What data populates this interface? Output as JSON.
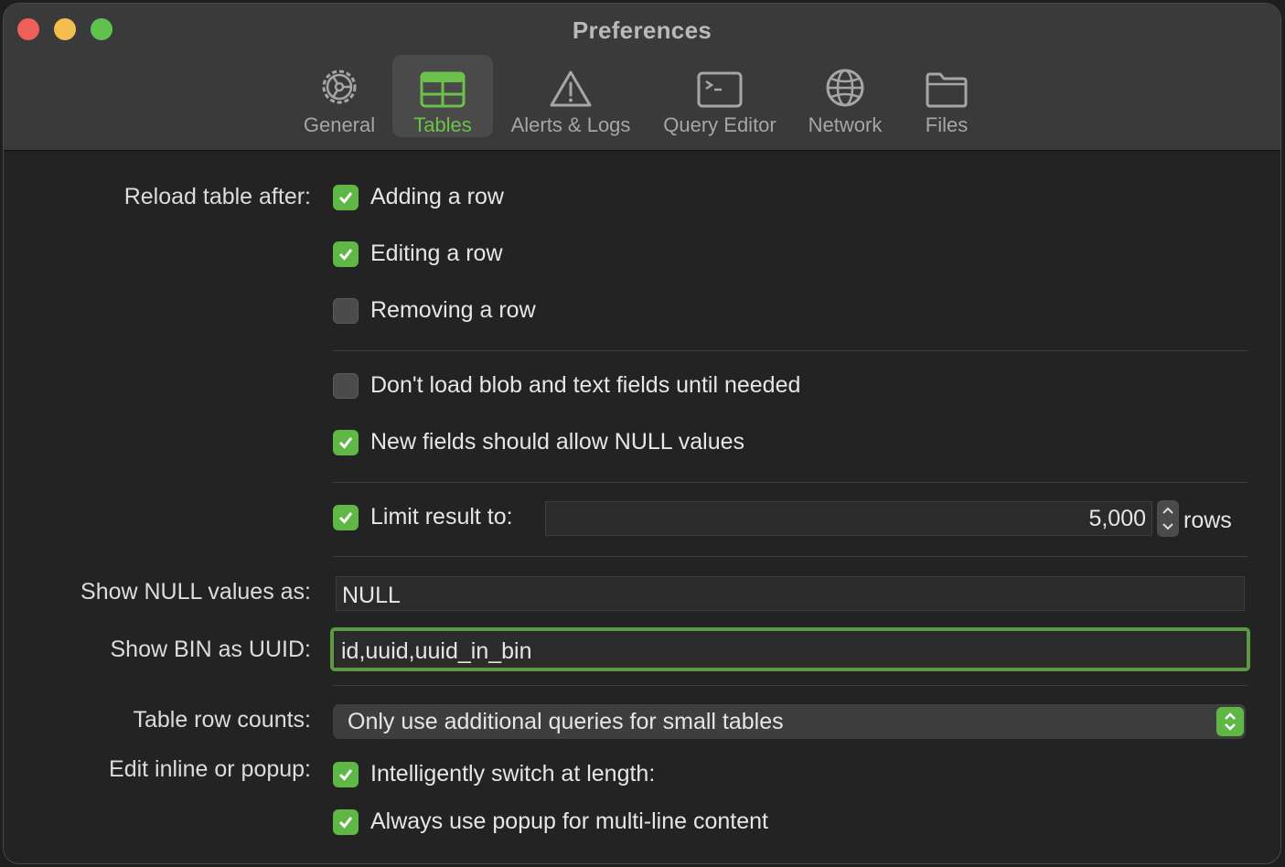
{
  "window": {
    "title": "Preferences"
  },
  "tabs": [
    {
      "label": "General",
      "icon": "gear-icon"
    },
    {
      "label": "Tables",
      "icon": "table-icon",
      "selected": true
    },
    {
      "label": "Alerts & Logs",
      "icon": "warning-triangle-icon"
    },
    {
      "label": "Query Editor",
      "icon": "terminal-icon"
    },
    {
      "label": "Network",
      "icon": "globe-icon"
    },
    {
      "label": "Files",
      "icon": "folder-icon"
    }
  ],
  "reload": {
    "label": "Reload table after:",
    "options": [
      {
        "label": "Adding a row",
        "checked": true
      },
      {
        "label": "Editing a row",
        "checked": true
      },
      {
        "label": "Removing a row",
        "checked": false
      }
    ]
  },
  "fields": {
    "blob": {
      "label": "Don't load blob and text fields until needed",
      "checked": false
    },
    "allow_null": {
      "label": "New fields should allow NULL values",
      "checked": true
    }
  },
  "limit": {
    "label": "Limit result to:",
    "checked": true,
    "value": "5,000",
    "unit": "rows"
  },
  "null_display": {
    "label": "Show NULL values as:",
    "value": "NULL"
  },
  "bin_uuid": {
    "label": "Show BIN as UUID:",
    "value": "id,uuid,uuid_in_bin"
  },
  "row_counts": {
    "label": "Table row counts:",
    "selected": "Only use additional queries for small tables"
  },
  "edit_mode": {
    "label": "Edit inline or popup:",
    "options": [
      {
        "label": "Intelligently switch at length:",
        "checked": true
      },
      {
        "label": "Always use popup for multi-line content",
        "checked": true
      }
    ]
  },
  "colors": {
    "accent": "#6cc14a",
    "checkbox_on": "#5fb745",
    "focus_ring": "#5b9a43"
  }
}
